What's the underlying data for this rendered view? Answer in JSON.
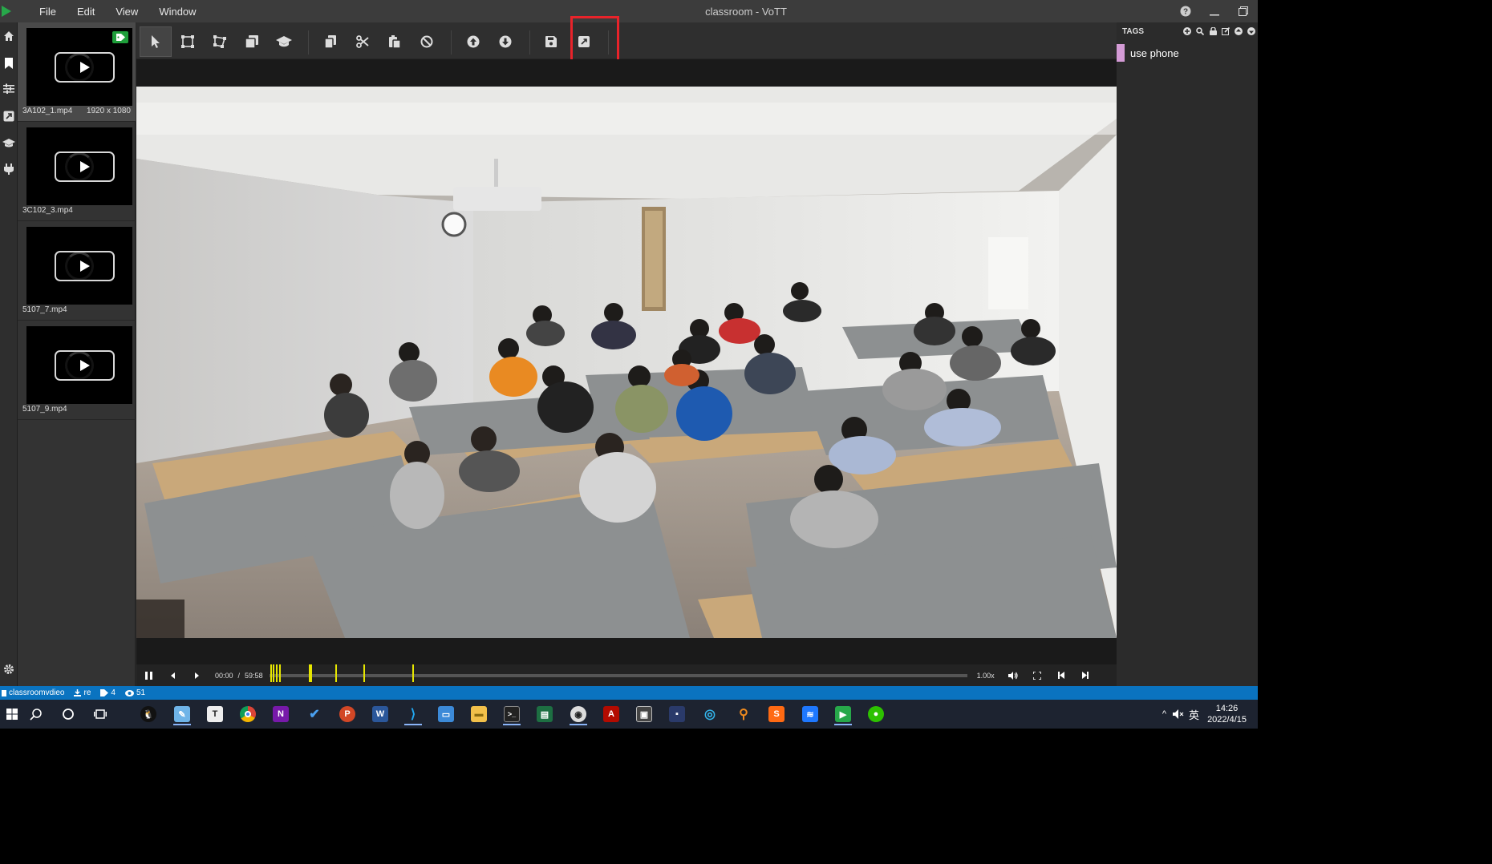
{
  "window": {
    "title": "classroom - VoTT",
    "menu": [
      "File",
      "Edit",
      "View",
      "Window"
    ]
  },
  "assets": [
    {
      "name": "3A102_1.mp4",
      "resolution": "1920 x 1080",
      "active": true,
      "tagged": true
    },
    {
      "name": "3C102_3.mp4",
      "resolution": "",
      "active": false,
      "tagged": false
    },
    {
      "name": "5107_7.mp4",
      "resolution": "",
      "active": false,
      "tagged": false
    },
    {
      "name": "5107_9.mp4",
      "resolution": "",
      "active": false,
      "tagged": false
    }
  ],
  "toolbar": {
    "tools": [
      "select-tool",
      "rectangle-tool",
      "polygon-tool",
      "copy-rectangle-tool",
      "active-learning-tool",
      "copy-regions-tool",
      "cut-regions-tool",
      "paste-regions-tool",
      "remove-regions-tool",
      "previous-asset-tool",
      "next-asset-tool",
      "save-project-tool",
      "export-project-tool"
    ]
  },
  "player": {
    "current_time": "00:00",
    "separator": "/",
    "duration": "59:58",
    "speed": "1.00x",
    "keyframes": [
      0.2,
      0.5,
      1.0,
      1.4,
      5.7,
      5.9,
      9.5,
      13.5,
      20.5
    ]
  },
  "tags": {
    "title": "TAGS",
    "items": [
      {
        "name": "use phone",
        "color": "#d49bd6"
      }
    ]
  },
  "status": {
    "project": "classroomvdieo",
    "connection": "re",
    "tag_count": "4",
    "visited_count": "51"
  },
  "taskbar": {
    "time": "14:26",
    "date": "2022/4/15",
    "ime": "英",
    "apps": [
      "qq-icon",
      "note-icon",
      "typora-icon",
      "chrome-icon",
      "onenote-icon",
      "todo-icon",
      "powerpoint-icon",
      "word-icon",
      "vscode-icon",
      "remote-icon",
      "explorer-icon",
      "terminal-icon",
      "excel-icon",
      "obs-icon",
      "acrobat-icon",
      "photos-icon",
      "tools-icon",
      "edge-dev-icon",
      "search-app-icon",
      "sublime-icon",
      "lark-icon",
      "vott-icon",
      "wechat-icon"
    ]
  }
}
